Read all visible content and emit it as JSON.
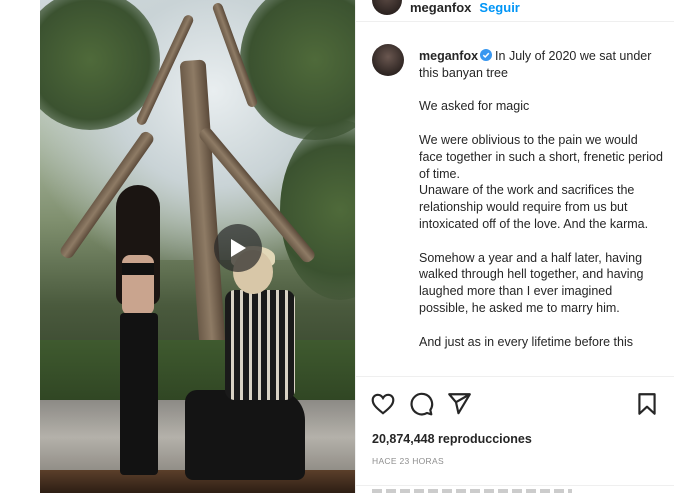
{
  "header": {
    "username": "meganfox",
    "follow_label": "Seguir"
  },
  "caption": {
    "username": "meganfox",
    "paragraphs": [
      "In July of 2020 we sat under this banyan tree",
      "We asked for magic",
      "We were oblivious to the pain we would face together in such a short, frenetic period of time.",
      "Unaware of the work and sacrifices the relationship would require from us but intoxicated off of the love. And the karma.",
      "Somehow a year and a half later, having walked through hell together, and having laughed more than I ever imagined possible, he asked me to marry him.",
      "And just as in every lifetime before this"
    ]
  },
  "media": {
    "play_icon": "play-icon"
  },
  "actions": {
    "like_icon": "heart-icon",
    "comment_icon": "comment-icon",
    "share_icon": "send-icon",
    "save_icon": "bookmark-icon"
  },
  "stats": {
    "views": "20,874,448 reproducciones",
    "time_ago": "HACE 23 HORAS"
  },
  "colors": {
    "accent": "#0095f6",
    "verified": "#3897f0",
    "text": "#262626",
    "muted": "#8e8e8e"
  }
}
